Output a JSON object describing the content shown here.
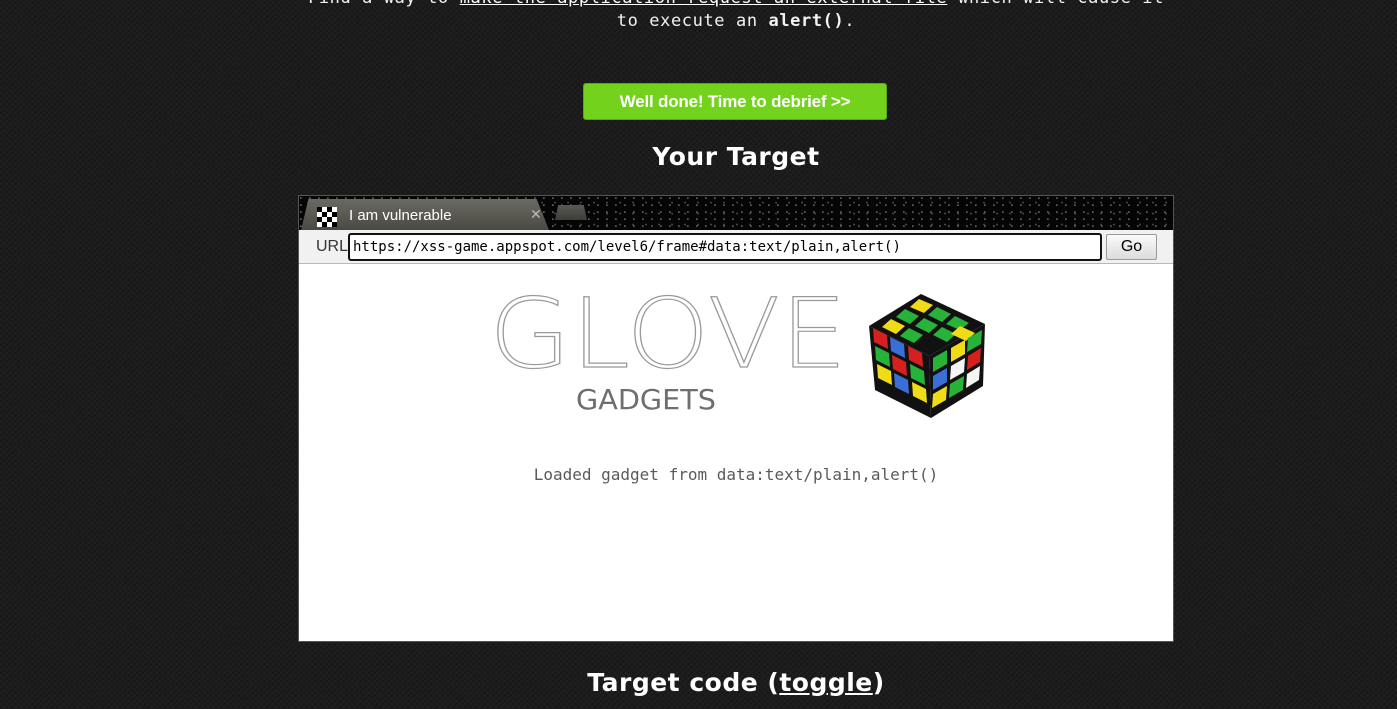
{
  "mission": {
    "prefix": "Find a way to ",
    "link_text": "make the application request an external file",
    "middle": " which will cause it to execute an ",
    "code": "alert()",
    "suffix": "."
  },
  "debrief_button": "Well done! Time to debrief >>",
  "target_title": "Your Target",
  "browser": {
    "tab_title": "I am vulnerable",
    "url_label": "URL",
    "url_value": "https://xss-game.appspot.com/level6/frame#data:text/plain,alert()",
    "go_label": "Go"
  },
  "page": {
    "logo_word": "GLOVE",
    "logo_sub": "GADGETS",
    "loaded_message": "Loaded gadget from data:text/plain,alert()"
  },
  "code_section": {
    "title_prefix": "Target code (",
    "toggle_link": "toggle",
    "title_suffix": ")"
  },
  "colors": {
    "background": "#1c1c1c",
    "accent_green": "#73d21b"
  }
}
